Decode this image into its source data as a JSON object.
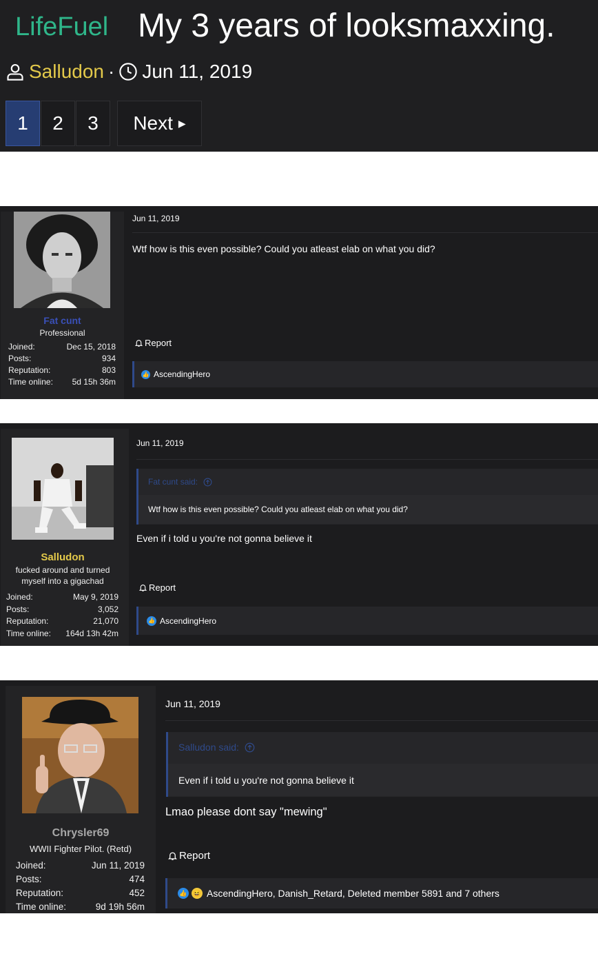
{
  "thread": {
    "prefix": "LifeFuel",
    "title": "My 3 years of looksmaxxing.",
    "author": "Salludon",
    "separator": "·",
    "date": "Jun 11, 2019"
  },
  "pagination": {
    "pages": [
      "1",
      "2",
      "3"
    ],
    "current": "1",
    "next_label": "Next"
  },
  "colors": {
    "prefix": "#2fb68a",
    "author_gold": "#e3c94a",
    "username_blue": "#3a50b8",
    "username_grey": "#a8a8a8",
    "active_page": "#263d72",
    "quote_accent": "#2f4a8a",
    "like_blue": "#2a8be8"
  },
  "labels": {
    "joined": "Joined:",
    "posts": "Posts:",
    "reputation": "Reputation:",
    "time_online": "Time online:",
    "report": "Report"
  },
  "posts": [
    {
      "username": "Fat cunt",
      "user_title": "Professional",
      "joined": "Dec 15, 2018",
      "posts": "934",
      "reputation": "803",
      "time_online": "5d 15h 36m",
      "date": "Jun 11, 2019",
      "message": "Wtf how is this even possible? Could you atleast elab on what you did?",
      "reactions": "AscendingHero",
      "avatar_icon": "portrait-photo-icon"
    },
    {
      "username": "Salludon",
      "user_title": "fucked around and turned myself into a gigachad",
      "joined": "May 9, 2019",
      "posts": "3,052",
      "reputation": "21,070",
      "time_online": "164d 13h 42m",
      "date": "Jun 11, 2019",
      "quote_author": "Fat cunt said:",
      "quote_text": "Wtf how is this even possible? Could you atleast elab on what you did?",
      "message": "Even if i told u you're not gonna believe it",
      "reactions": "AscendingHero",
      "avatar_icon": "boxer-photo-icon"
    },
    {
      "username": "Chrysler69",
      "user_title": "WWII Fighter Pilot. (Retd)",
      "joined": "Jun 11, 2019",
      "posts": "474",
      "reputation": "452",
      "time_online": "9d 19h 56m",
      "date": "Jun 11, 2019",
      "quote_author": "Salludon said:",
      "quote_text": "Even if i told u you're not gonna believe it",
      "message": "Lmao please dont say \"mewing\"",
      "reactions": "AscendingHero, Danish_Retard, Deleted member 5891 and 7 others",
      "avatar_icon": "old-man-photo-icon"
    }
  ]
}
